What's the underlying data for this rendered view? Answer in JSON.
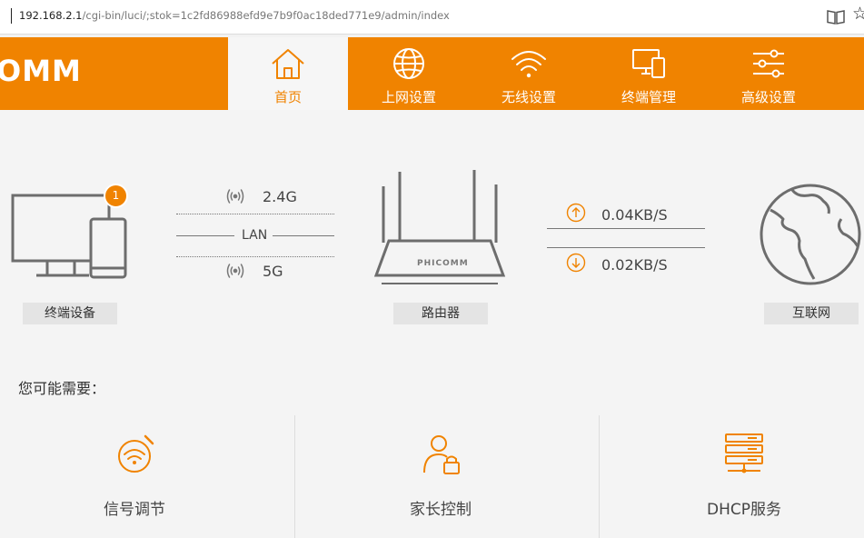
{
  "address_bar": {
    "host": "192.168.2.1",
    "path": "/cgi-bin/luci/;stok=1c2fd86988efd9e7b9f0ac18ded771e9/admin/index",
    "star": "☆"
  },
  "brand": {
    "text": "OMM"
  },
  "nav": {
    "tabs": [
      {
        "label": "首页",
        "icon": "home-icon",
        "active": true
      },
      {
        "label": "上网设置",
        "icon": "globe-icon"
      },
      {
        "label": "无线设置",
        "icon": "wifi-icon"
      },
      {
        "label": "终端管理",
        "icon": "devices-icon"
      },
      {
        "label": "高级设置",
        "icon": "sliders-icon"
      }
    ]
  },
  "topology": {
    "devices_label": "终端设备",
    "device_count": "1",
    "band_24": "2.4G",
    "lan": "LAN",
    "band_5": "5G",
    "router_brand": "PHICOMM",
    "router_label": "路由器",
    "upload": "0.04KB/S",
    "download": "0.02KB/S",
    "internet_label": "互联网"
  },
  "quick": {
    "heading": "您可能需要：",
    "items": [
      {
        "label": "信号调节",
        "icon": "signal-adjust-icon"
      },
      {
        "label": "家长控制",
        "icon": "parental-control-icon"
      },
      {
        "label": "DHCP服务",
        "icon": "dhcp-server-icon"
      }
    ]
  },
  "colors": {
    "accent": "#f08300",
    "line": "#777777"
  }
}
